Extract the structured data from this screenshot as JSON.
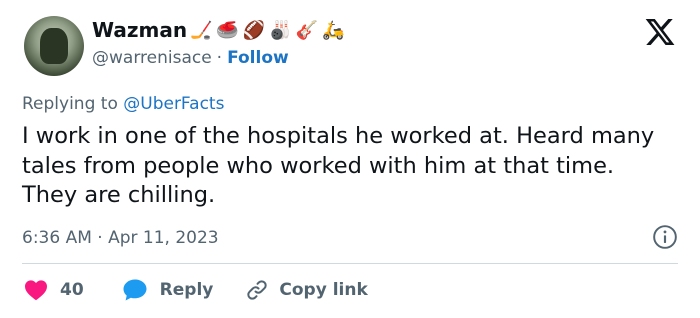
{
  "author": {
    "name": "Wazman",
    "emojis": [
      "🏒",
      "🥌",
      "🏈",
      "🎳",
      "🎸",
      "🛵"
    ],
    "handle": "@warrenisace",
    "separator": "·",
    "follow_label": "Follow"
  },
  "reply_context": {
    "prefix": "Replying to",
    "mention": "@UberFacts"
  },
  "tweet": {
    "text": "I work in one of the hospitals he worked at.  Heard many tales from people who worked with him at that time. They are chilling.",
    "time": "6:36 AM · Apr 11, 2023"
  },
  "actions": {
    "likes": "40",
    "reply_label": "Reply",
    "copy_link_label": "Copy link"
  },
  "colors": {
    "link": "#1d74c4",
    "heart": "#f91880",
    "reply_bubble": "#1d9bf0",
    "muted": "#536471"
  },
  "icons": [
    "x-logo-icon",
    "info-icon",
    "heart-icon",
    "reply-bubble-icon",
    "link-icon"
  ]
}
